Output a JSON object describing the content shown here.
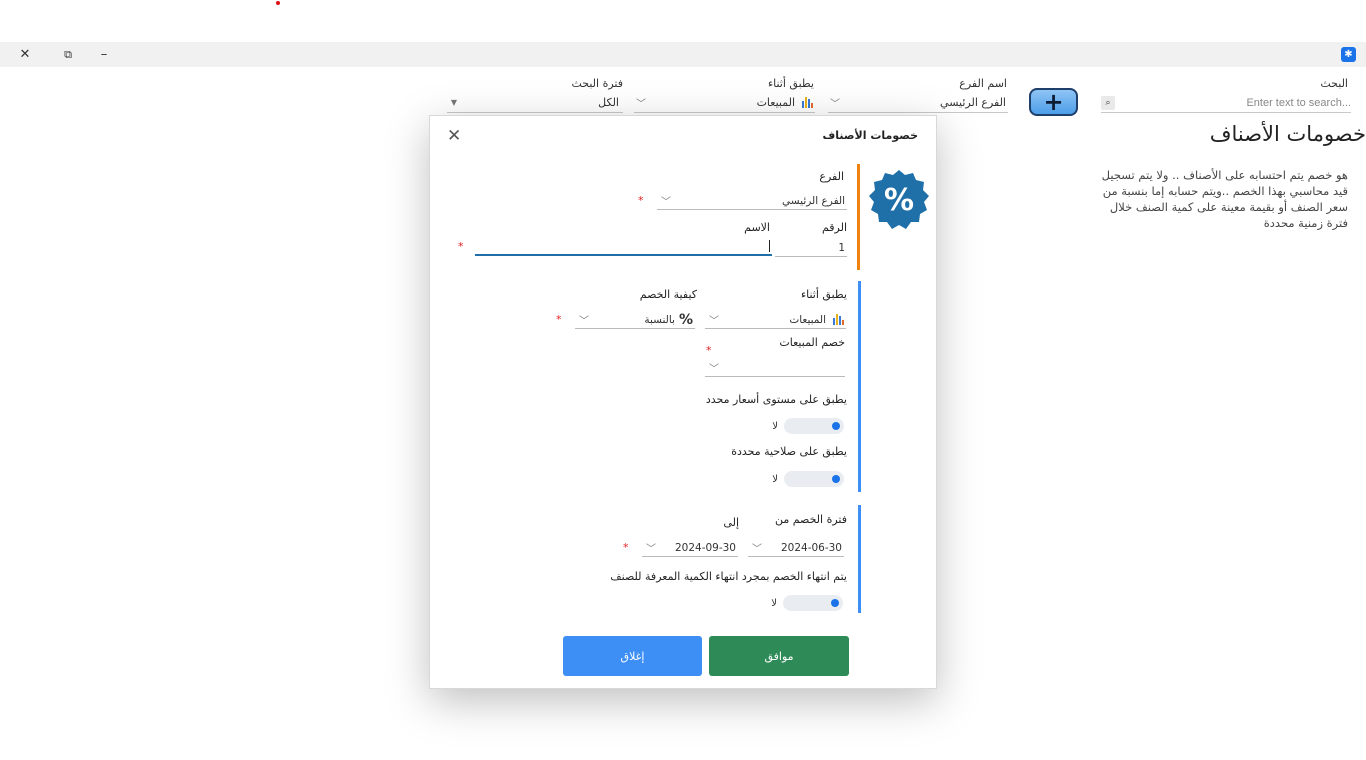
{
  "window": {
    "close_glyph": "✕",
    "restore_glyph": "⧉",
    "minimize_glyph": "–",
    "app_icon": "app-icon"
  },
  "filters": {
    "search_label": "البحث",
    "search_placeholder": "Enter text to search...",
    "branch_label": "اسم الفرع",
    "branch_value": "الفرع الرئيسي",
    "apply_label": "يطبق أثناء",
    "apply_value": "المبيعات",
    "period_label": "فترة البحث",
    "period_value": "الكل",
    "add_glyph": "+"
  },
  "page": {
    "title": "خصومات الأصناف",
    "description": "هو خصم يتم احتسابه على الأصناف .. ولا يتم تسجيل قيد محاسبي بهذا الخصم ..ويتم حسابه إما بنسبة من سعر الصنف أو بقيمة معينة على كمية الصنف خلال فترة زمنية محددة"
  },
  "dialog": {
    "title": "خصومات الأصناف",
    "close_glyph": "✕",
    "badge_glyph": "%",
    "branch_label": "الفرع",
    "branch_value": "الفرع الرئيسي",
    "number_label": "الرقم",
    "number_value": "1",
    "name_label": "الاسم",
    "name_value": "",
    "apply_label": "يطبق أثناء",
    "apply_value": "المبيعات",
    "method_label": "كيفية الخصم",
    "method_icon_glyph": "%",
    "method_value": "بالنسبة",
    "sales_discount_label": "خصم المبيعات",
    "sales_discount_value": "",
    "price_level_label": "يطبق على مستوى أسعار محدد",
    "price_level_toggle": "لا",
    "permission_label": "يطبق على صلاحية محددة",
    "permission_toggle": "لا",
    "period_from_label": "فترة الخصم من",
    "period_to_label": "إلى",
    "from_date": "2024-06-30",
    "to_date": "2024-09-30",
    "end_qty_label": "يتم انتهاء الخصم بمجرد انتهاء الكمية المعرفة للصنف",
    "end_qty_toggle": "لا",
    "ok_label": "موافق",
    "close_label": "إغلاق",
    "required_mark": "*"
  },
  "colors": {
    "accent_orange": "#f0820f",
    "accent_blue": "#3d8ef5",
    "ok_green": "#2e8b57",
    "badge_blue": "#1f6fa8"
  }
}
